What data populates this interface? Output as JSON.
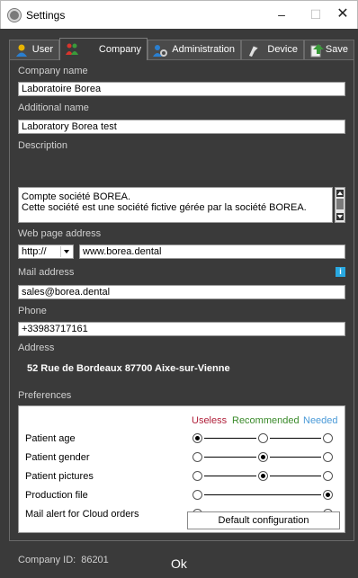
{
  "window": {
    "title": "Settings",
    "minimize_symbol": "–",
    "maximize_symbol": "☐",
    "close_symbol": "✕"
  },
  "tabs": [
    {
      "label": "User",
      "icon": "user-icon",
      "active": false
    },
    {
      "label": "Company",
      "icon": "company-icon",
      "active": true
    },
    {
      "label": "Administration",
      "icon": "administration-icon",
      "active": false
    },
    {
      "label": "Device",
      "icon": "device-icon",
      "active": false
    },
    {
      "label": "Save",
      "icon": "save-icon",
      "active": false
    }
  ],
  "form": {
    "company_name": {
      "label": "Company name",
      "value": "Laboratoire Borea"
    },
    "additional_name": {
      "label": "Additional name",
      "value": "Laboratory Borea test"
    },
    "description": {
      "label": "Description",
      "line1": "Compte société BOREA.",
      "line2": "Cette société est une société fictive gérée par la société BOREA."
    },
    "web_page": {
      "label": "Web page address",
      "protocol": "http://",
      "value": "www.borea.dental"
    },
    "mail": {
      "label": "Mail address",
      "value": "sales@borea.dental",
      "info_icon": "i"
    },
    "phone": {
      "label": "Phone",
      "value": "+33983717161"
    },
    "address": {
      "label": "Address",
      "value": "52 Rue de Bordeaux 87700 Aixe-sur-Vienne"
    }
  },
  "preferences": {
    "label": "Preferences",
    "headers": {
      "useless": "Useless",
      "recommended": "Recommended",
      "needed": "Needed"
    },
    "rows": [
      {
        "label": "Patient age",
        "selected": "useless",
        "options": 3
      },
      {
        "label": "Patient gender",
        "selected": "recommended",
        "options": 3
      },
      {
        "label": "Patient pictures",
        "selected": "recommended",
        "options": 3
      },
      {
        "label": "Production file",
        "selected": "needed",
        "options": 2
      },
      {
        "label": "Mail alert for Cloud orders",
        "selected": "needed",
        "options": 2
      }
    ],
    "default_button": "Default configuration"
  },
  "footer": {
    "company_id_label": "Company ID:",
    "company_id": "86201",
    "ok_label": "Ok"
  },
  "colors": {
    "background": "#3a3a3a",
    "useless": "#b0203a",
    "recommended": "#3a8a2a",
    "needed": "#4a9ad8",
    "info": "#29a8e0"
  }
}
